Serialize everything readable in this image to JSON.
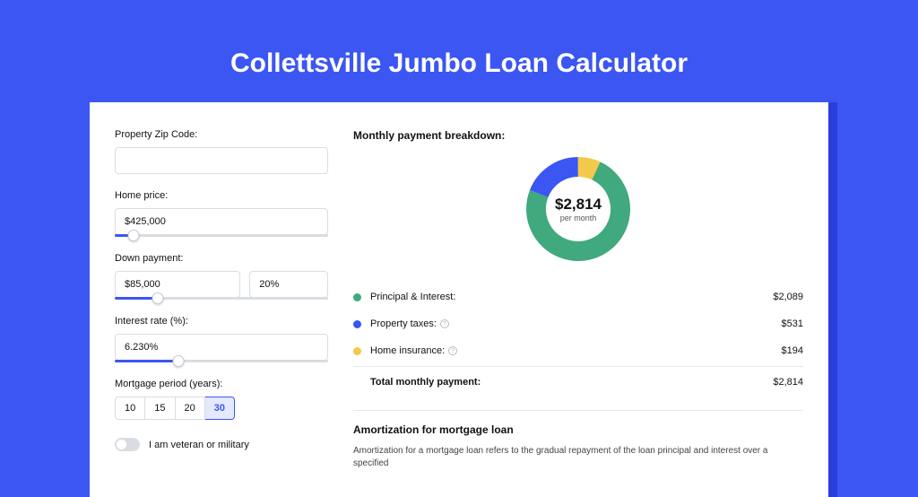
{
  "page_title": "Collettsville Jumbo Loan Calculator",
  "form": {
    "zip_label": "Property Zip Code:",
    "zip_value": "",
    "home_price_label": "Home price:",
    "home_price_value": "$425,000",
    "home_price_slider_pct": 9,
    "down_payment_label": "Down payment:",
    "down_payment_value": "$85,000",
    "down_payment_pct_value": "20%",
    "down_payment_slider_pct": 20,
    "interest_label": "Interest rate (%):",
    "interest_value": "6.230%",
    "interest_slider_pct": 30,
    "period_label": "Mortgage period (years):",
    "periods": [
      "10",
      "15",
      "20",
      "30"
    ],
    "period_active": "30",
    "veteran_label": "I am veteran or military"
  },
  "breakdown": {
    "title": "Monthly payment breakdown:",
    "total_amount": "$2,814",
    "total_sub": "per month",
    "items": [
      {
        "label": "Principal & Interest:",
        "value": "$2,089",
        "color": "#40a97d",
        "pct": 74,
        "info": false
      },
      {
        "label": "Property taxes:",
        "value": "$531",
        "color": "#3b56f3",
        "pct": 19,
        "info": true
      },
      {
        "label": "Home insurance:",
        "value": "$194",
        "color": "#f3c94b",
        "pct": 7,
        "info": true
      }
    ],
    "total_row_label": "Total monthly payment:",
    "total_row_value": "$2,814"
  },
  "amortization": {
    "title": "Amortization for mortgage loan",
    "text": "Amortization for a mortgage loan refers to the gradual repayment of the loan principal and interest over a specified"
  },
  "chart_data": {
    "type": "pie",
    "title": "Monthly payment breakdown",
    "series": [
      {
        "name": "Principal & Interest",
        "value": 2089,
        "color": "#40a97d"
      },
      {
        "name": "Property taxes",
        "value": 531,
        "color": "#3b56f3"
      },
      {
        "name": "Home insurance",
        "value": 194,
        "color": "#f3c94b"
      }
    ],
    "total": 2814,
    "center_label": "$2,814 per month"
  }
}
